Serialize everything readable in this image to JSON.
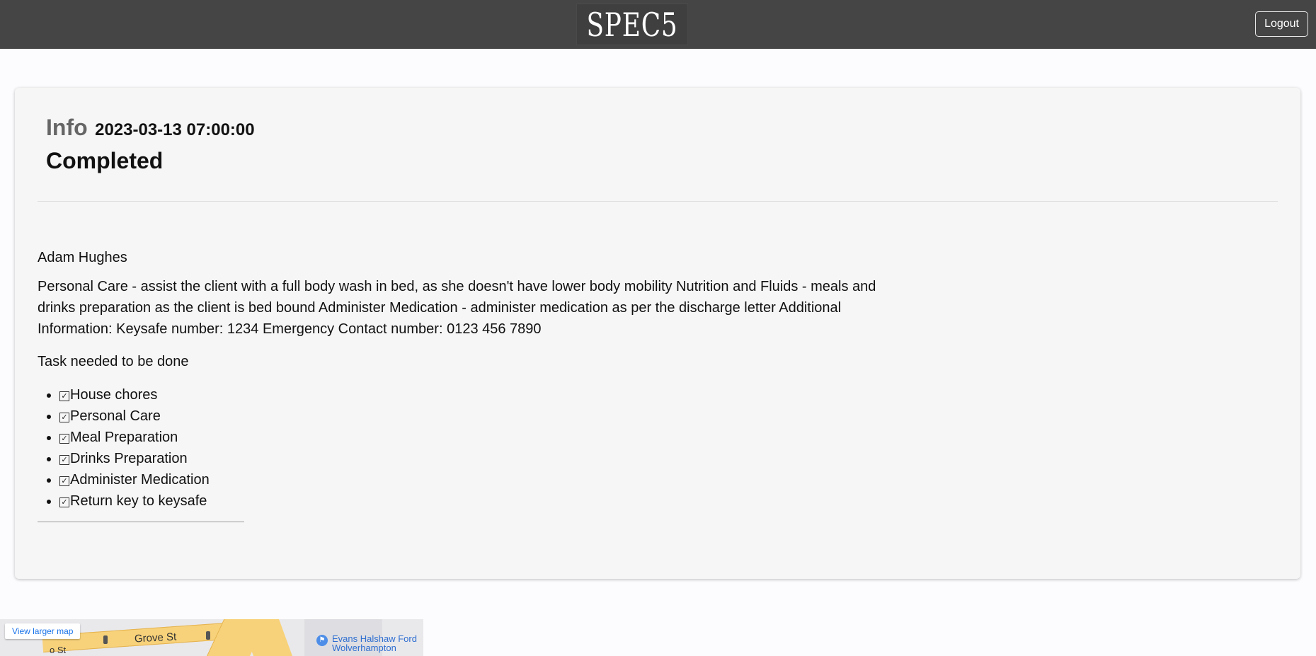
{
  "header": {
    "logo_text": "SPEC5",
    "logout_label": "Logout"
  },
  "visit": {
    "info_label": "Info",
    "datetime": "2023-03-13 07:00:00",
    "status": "Completed",
    "client_name": "Adam Hughes",
    "description": "Personal Care - assist the client with a full body wash in bed, as she doesn't have lower body mobility Nutrition and Fluids - meals and drinks preparation as the client is bed bound Administer Medication - administer medication as per the discharge letter Additional Information: Keysafe number: 1234 Emergency Contact number: 0123 456 7890",
    "tasks_title": "Task needed to be done",
    "tasks": [
      "House chores",
      "Personal Care",
      "Meal Preparation",
      "Drinks Preparation",
      "Administer Medication",
      "Return key to keysafe"
    ]
  },
  "map": {
    "view_larger_label": "View larger map",
    "street_main": "Grove St",
    "street_fragment": "o St",
    "poi_line1": "Evans Halshaw Ford",
    "poi_line2": "Wolverhampton",
    "colors": {
      "road": "#f8d27a",
      "link": "#1a73e8"
    }
  },
  "colors": {
    "topbar": "#454545",
    "card": "#f6f6f6"
  }
}
